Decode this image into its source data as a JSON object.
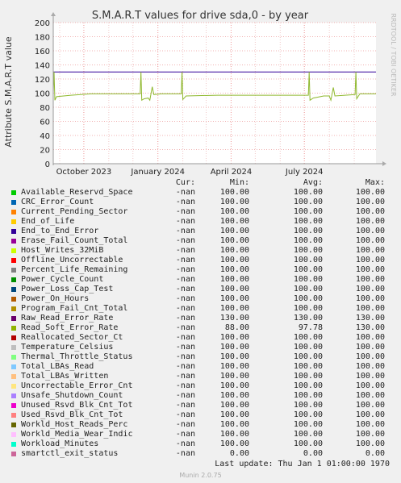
{
  "chart_data": {
    "type": "line",
    "title": "S.M.A.R.T values for drive sda,0 - by year",
    "ylabel": "Attribute S.M.A.R.T value",
    "ylim": [
      0,
      200
    ],
    "yticks": [
      0,
      20,
      40,
      60,
      80,
      100,
      120,
      140,
      160,
      180,
      200
    ],
    "xlim": [
      "2023-08-24",
      "2024-09-28"
    ],
    "xticks": [
      {
        "date": "2023-10-01",
        "label": "October 2023"
      },
      {
        "date": "2024-01-01",
        "label": "January 2024"
      },
      {
        "date": "2024-04-01",
        "label": "April 2024"
      },
      {
        "date": "2024-07-01",
        "label": "July 2024"
      }
    ],
    "grid": true,
    "side_text": "RRDTOOL / TOBI OETIKER",
    "series": [
      {
        "name": "Raw_Read_Error_Rate",
        "color": "#330099",
        "points": [
          [
            "2023-08-24",
            130
          ],
          [
            "2024-09-28",
            130
          ]
        ]
      },
      {
        "name": "Read_Soft_Error_Rate",
        "color": "#8fb82e",
        "points": [
          [
            "2023-08-24",
            100
          ],
          [
            "2023-08-25",
            130
          ],
          [
            "2023-08-26",
            90
          ],
          [
            "2023-08-28",
            95
          ],
          [
            "2023-09-15",
            97
          ],
          [
            "2023-10-10",
            99
          ],
          [
            "2023-11-15",
            99
          ],
          [
            "2023-12-10",
            99
          ],
          [
            "2023-12-11",
            130
          ],
          [
            "2023-12-12",
            90
          ],
          [
            "2023-12-15",
            92
          ],
          [
            "2023-12-20",
            93
          ],
          [
            "2023-12-22",
            90
          ],
          [
            "2023-12-25",
            109
          ],
          [
            "2023-12-27",
            98
          ],
          [
            "2024-01-05",
            99
          ],
          [
            "2024-01-30",
            99
          ],
          [
            "2024-01-31",
            130
          ],
          [
            "2024-02-01",
            91
          ],
          [
            "2024-02-05",
            96
          ],
          [
            "2024-03-15",
            97
          ],
          [
            "2024-05-15",
            97
          ],
          [
            "2024-06-30",
            97
          ],
          [
            "2024-07-06",
            97
          ],
          [
            "2024-07-07",
            130
          ],
          [
            "2024-07-08",
            90
          ],
          [
            "2024-07-12",
            93
          ],
          [
            "2024-07-25",
            96
          ],
          [
            "2024-08-01",
            96
          ],
          [
            "2024-08-03",
            90
          ],
          [
            "2024-08-06",
            108
          ],
          [
            "2024-08-08",
            96
          ],
          [
            "2024-09-02",
            98
          ],
          [
            "2024-09-03",
            130
          ],
          [
            "2024-09-04",
            92
          ],
          [
            "2024-09-08",
            99
          ],
          [
            "2024-09-28",
            99
          ]
        ]
      },
      {
        "name": "smartctl_exit_status",
        "color": "#cc6699",
        "dashed": true,
        "points": [
          [
            "2023-08-24",
            0
          ],
          [
            "2024-09-28",
            0
          ]
        ]
      }
    ]
  },
  "legend": {
    "headers": {
      "cur": "Cur:",
      "min": "Min:",
      "avg": "Avg:",
      "max": "Max:"
    },
    "rows": [
      {
        "name": "Available_Reservd_Space",
        "color": "#00cc00",
        "cur": "-nan",
        "min": "100.00",
        "avg": "100.00",
        "max": "100.00"
      },
      {
        "name": "CRC_Error_Count",
        "color": "#0066b3",
        "cur": "-nan",
        "min": "100.00",
        "avg": "100.00",
        "max": "100.00"
      },
      {
        "name": "Current_Pending_Sector",
        "color": "#ff8000",
        "cur": "-nan",
        "min": "100.00",
        "avg": "100.00",
        "max": "100.00"
      },
      {
        "name": "End_of_Life",
        "color": "#ffcc00",
        "cur": "-nan",
        "min": "100.00",
        "avg": "100.00",
        "max": "100.00"
      },
      {
        "name": "End_to_End_Error",
        "color": "#330099",
        "cur": "-nan",
        "min": "100.00",
        "avg": "100.00",
        "max": "100.00"
      },
      {
        "name": "Erase_Fail_Count_Total",
        "color": "#990099",
        "cur": "-nan",
        "min": "100.00",
        "avg": "100.00",
        "max": "100.00"
      },
      {
        "name": "Host_Writes_32MiB",
        "color": "#ccff00",
        "cur": "-nan",
        "min": "100.00",
        "avg": "100.00",
        "max": "100.00"
      },
      {
        "name": "Offline_Uncorrectable",
        "color": "#ff0000",
        "cur": "-nan",
        "min": "100.00",
        "avg": "100.00",
        "max": "100.00"
      },
      {
        "name": "Percent_Life_Remaining",
        "color": "#808080",
        "cur": "-nan",
        "min": "100.00",
        "avg": "100.00",
        "max": "100.00"
      },
      {
        "name": "Power_Cycle_Count",
        "color": "#008f00",
        "cur": "-nan",
        "min": "100.00",
        "avg": "100.00",
        "max": "100.00"
      },
      {
        "name": "Power_Loss_Cap_Test",
        "color": "#00487d",
        "cur": "-nan",
        "min": "100.00",
        "avg": "100.00",
        "max": "100.00"
      },
      {
        "name": "Power_On_Hours",
        "color": "#b35a00",
        "cur": "-nan",
        "min": "100.00",
        "avg": "100.00",
        "max": "100.00"
      },
      {
        "name": "Program_Fail_Cnt_Total",
        "color": "#b38f00",
        "cur": "-nan",
        "min": "100.00",
        "avg": "100.00",
        "max": "100.00"
      },
      {
        "name": "Raw_Read_Error_Rate",
        "color": "#6b006b",
        "cur": "-nan",
        "min": "130.00",
        "avg": "130.00",
        "max": "130.00"
      },
      {
        "name": "Read_Soft_Error_Rate",
        "color": "#8fb300",
        "cur": "-nan",
        "min": "88.00",
        "avg": "97.78",
        "max": "130.00"
      },
      {
        "name": "Reallocated_Sector_Ct",
        "color": "#b30000",
        "cur": "-nan",
        "min": "100.00",
        "avg": "100.00",
        "max": "100.00"
      },
      {
        "name": "Temperature_Celsius",
        "color": "#bebebe",
        "cur": "-nan",
        "min": "100.00",
        "avg": "100.00",
        "max": "100.00"
      },
      {
        "name": "Thermal_Throttle_Status",
        "color": "#80ff80",
        "cur": "-nan",
        "min": "100.00",
        "avg": "100.00",
        "max": "100.00"
      },
      {
        "name": "Total_LBAs_Read",
        "color": "#80c9ff",
        "cur": "-nan",
        "min": "100.00",
        "avg": "100.00",
        "max": "100.00"
      },
      {
        "name": "Total_LBAs_Written",
        "color": "#ffc080",
        "cur": "-nan",
        "min": "100.00",
        "avg": "100.00",
        "max": "100.00"
      },
      {
        "name": "Uncorrectable_Error_Cnt",
        "color": "#ffe680",
        "cur": "-nan",
        "min": "100.00",
        "avg": "100.00",
        "max": "100.00"
      },
      {
        "name": "Unsafe_Shutdown_Count",
        "color": "#aa80ff",
        "cur": "-nan",
        "min": "100.00",
        "avg": "100.00",
        "max": "100.00"
      },
      {
        "name": "Unused_Rsvd_Blk_Cnt_Tot",
        "color": "#ee00cc",
        "cur": "-nan",
        "min": "100.00",
        "avg": "100.00",
        "max": "100.00"
      },
      {
        "name": "Used_Rsvd_Blk_Cnt_Tot",
        "color": "#ff8080",
        "cur": "-nan",
        "min": "100.00",
        "avg": "100.00",
        "max": "100.00"
      },
      {
        "name": "Workld_Host_Reads_Perc",
        "color": "#666600",
        "cur": "-nan",
        "min": "100.00",
        "avg": "100.00",
        "max": "100.00"
      },
      {
        "name": "Workld_Media_Wear_Indic",
        "color": "#ffbfff",
        "cur": "-nan",
        "min": "100.00",
        "avg": "100.00",
        "max": "100.00"
      },
      {
        "name": "Workload_Minutes",
        "color": "#00ffcc",
        "cur": "-nan",
        "min": "100.00",
        "avg": "100.00",
        "max": "100.00"
      },
      {
        "name": "smartctl_exit_status",
        "color": "#cc6699",
        "cur": "-nan",
        "min": "0.00",
        "avg": "0.00",
        "max": "0.00"
      }
    ]
  },
  "footer": {
    "last_update": "Last update: Thu Jan  1 01:00:00 1970",
    "munin_version": "Munin 2.0.75"
  }
}
